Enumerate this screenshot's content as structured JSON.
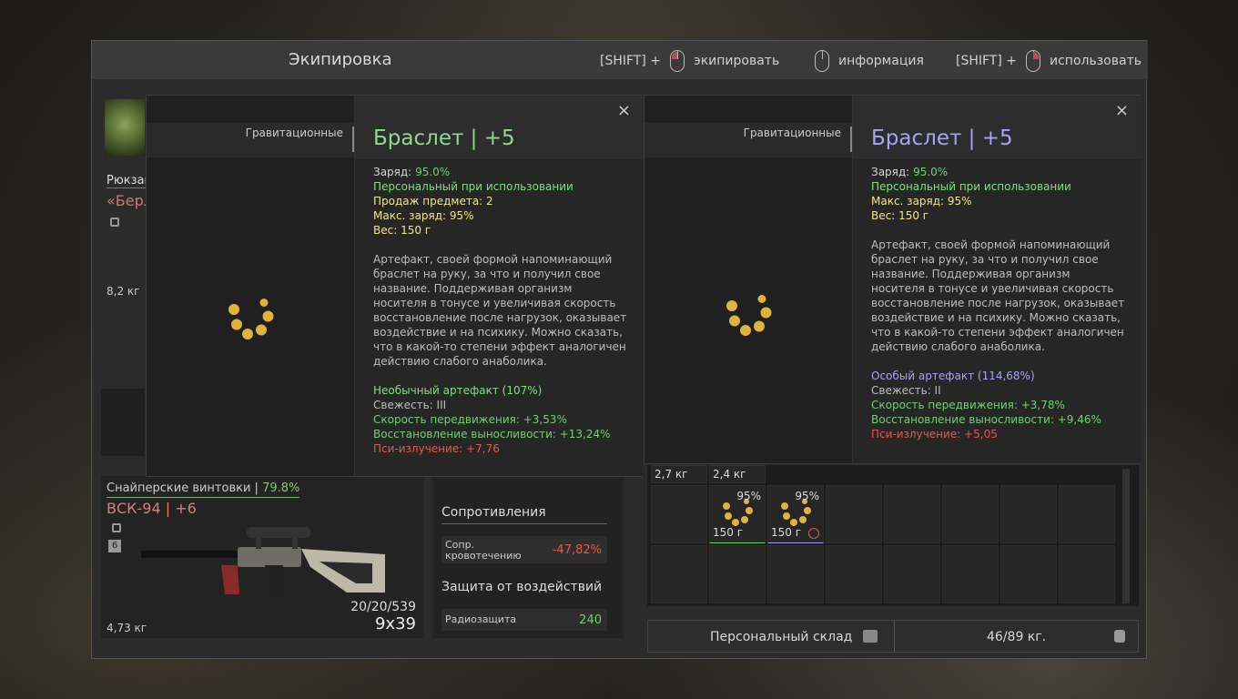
{
  "window": {
    "title": "Экипировка",
    "hints": [
      {
        "prefix": "[SHIFT] +",
        "label": "экипировать"
      },
      {
        "prefix": "",
        "label": "информация"
      },
      {
        "prefix": "[SHIFT] +",
        "label": "использовать"
      }
    ]
  },
  "left": {
    "backpack_label": "Рюкзак",
    "backpack_name": "«Берлога»",
    "backpack_weight": "8,2 кг",
    "weapon": {
      "category": "Снайперские винтовки",
      "condition": "79.8%",
      "name": "ВСК-94 | +6",
      "slot_number": "6",
      "ammo": "20/20/539",
      "caliber": "9x39",
      "weight": "4,73 кг"
    },
    "resistances": {
      "title": "Сопротивления",
      "bleeding_label_1": "Сопр.",
      "bleeding_label_2": "кровотечению",
      "bleeding_value": "-47,82%",
      "protection_title": "Защита от воздействий",
      "radiation_label": "Радиозащита",
      "radiation_value": "240"
    }
  },
  "inventory": {
    "cells": [
      {
        "weight": "2,7 кг",
        "charge": ""
      },
      {
        "weight": "2,4 кг",
        "charge": ""
      },
      {
        "weight": "150 г",
        "charge": "95%"
      },
      {
        "weight": "150 г",
        "charge": "95%"
      }
    ],
    "storage_label": "Персональный склад",
    "storage_weight": "46/89 кг."
  },
  "tooltip_left": {
    "category": "Гравитационные",
    "name": "Браслет | +5",
    "charge_label": "Заряд:",
    "charge_value": "95.0%",
    "personal": "Персональный при использовании",
    "sales": "Продаж предмета: 2",
    "max_charge": "Макс. заряд: 95%",
    "weight": "Вес: 150 г",
    "description": "Артефакт, своей формой напоминающий браслет на руку, за что и получил свое название. Поддерживая организм носителя в тонусе и увеличивая скорость восстановление после нагрузок, оказывает воздействие и на психику. Можно сказать, что в какой-то степени эффект аналогичен действию слабого анаболика.",
    "rarity": "Необычный артефакт (107%)",
    "freshness": "Свежесть: III",
    "speed": "Скорость передвижения: +3,53%",
    "stamina": "Восстановление выносливости: +13,24%",
    "psi": "Пси-излучение: +7,76",
    "close": "×"
  },
  "tooltip_right": {
    "category": "Гравитационные",
    "name": "Браслет | +5",
    "charge_label": "Заряд:",
    "charge_value": "95.0%",
    "personal": "Персональный при использовании",
    "max_charge": "Макс. заряд: 95%",
    "weight": "Вес: 150 г",
    "description": "Артефакт, своей формой напоминающий браслет на руку, за что и получил свое название. Поддерживая организм носителя в тонусе и увеличивая скорость восстановление после нагрузок, оказывает воздействие и на психику. Можно сказать, что в какой-то степени эффект аналогичен действию слабого анаболика.",
    "rarity": "Особый артефакт (114,68%)",
    "freshness": "Свежесть: II",
    "speed": "Скорость передвижения: +3,78%",
    "stamina": "Восстановление выносливости: +9,46%",
    "psi": "Пси-излучение: +5,05",
    "close": "×"
  },
  "colors": {
    "uncommon_name": "#8fd98f",
    "special_name": "#a7a3f4",
    "negative": "#e05a4f",
    "positive": "#6ed36e"
  },
  "icons": [
    "mouse-left-icon",
    "mouse-right-icon",
    "lock-icon",
    "close-icon",
    "storage-icon",
    "weight-icon",
    "bracelet-artifact-icon",
    "sniper-rifle-icon",
    "timer-icon"
  ]
}
